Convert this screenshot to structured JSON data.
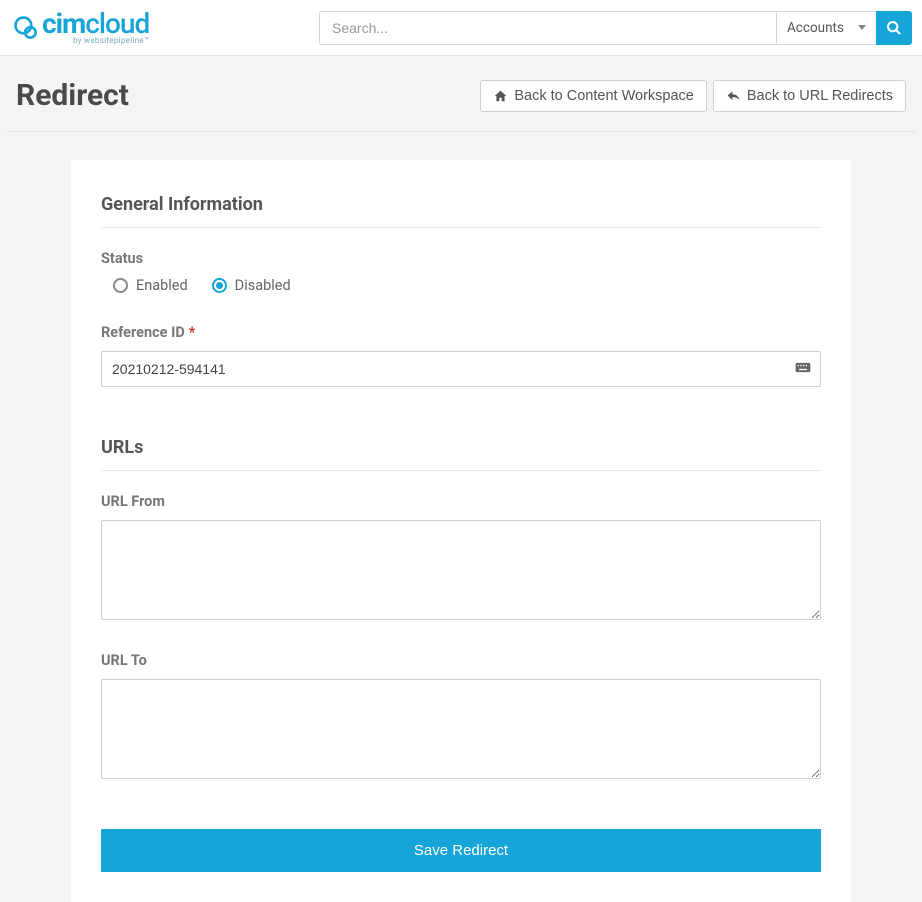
{
  "header": {
    "logo_main": "cimcloud",
    "logo_sub": "by websitepipeline™",
    "search_placeholder": "Search...",
    "search_scope": "Accounts"
  },
  "page": {
    "title": "Redirect",
    "back_content": "Back to Content Workspace",
    "back_url_redirects": "Back to URL Redirects"
  },
  "form": {
    "section_general": "General Information",
    "status_label": "Status",
    "status_options": {
      "enabled": "Enabled",
      "disabled": "Disabled"
    },
    "status_value": "disabled",
    "reference_id_label": "Reference ID",
    "reference_id_value": "20210212-594141",
    "section_urls": "URLs",
    "url_from_label": "URL From",
    "url_from_value": "",
    "url_to_label": "URL To",
    "url_to_value": "",
    "save_label": "Save Redirect"
  }
}
